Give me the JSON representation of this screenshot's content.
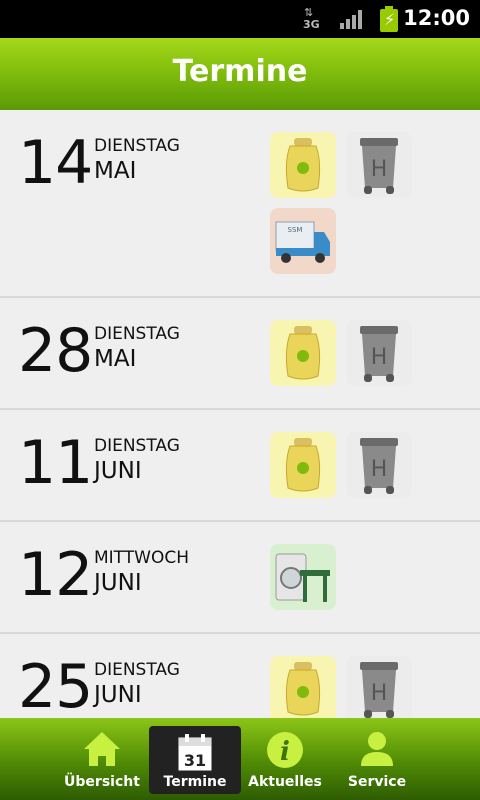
{
  "status": {
    "network": "3G",
    "time": "12:00"
  },
  "header": {
    "title": "Termine"
  },
  "rows": [
    {
      "day": "14",
      "weekday": "DIENSTAG",
      "month": "MAI",
      "icons": [
        "yellow-bag-icon",
        "grey-bin-icon",
        "truck-icon"
      ]
    },
    {
      "day": "28",
      "weekday": "DIENSTAG",
      "month": "MAI",
      "icons": [
        "yellow-bag-icon",
        "grey-bin-icon"
      ]
    },
    {
      "day": "11",
      "weekday": "DIENSTAG",
      "month": "JUNI",
      "icons": [
        "yellow-bag-icon",
        "grey-bin-icon"
      ]
    },
    {
      "day": "12",
      "weekday": "MITTWOCH",
      "month": "JUNI",
      "icons": [
        "washer-table-icon"
      ]
    },
    {
      "day": "25",
      "weekday": "DIENSTAG",
      "month": "JUNI",
      "icons": [
        "yellow-bag-icon",
        "grey-bin-icon"
      ]
    }
  ],
  "bin_letter": "H",
  "truck_label": "SSM",
  "nav": [
    {
      "label": "Übersicht",
      "icon": "home-icon"
    },
    {
      "label": "Termine",
      "icon": "calendar-icon",
      "calendar_day": "31",
      "active": true
    },
    {
      "label": "Aktuelles",
      "icon": "info-icon",
      "glyph": "i"
    },
    {
      "label": "Service",
      "icon": "person-icon"
    }
  ],
  "colors": {
    "accent": "#7fbb0c",
    "header_dark": "#5b9a07",
    "active_tab": "#222222"
  }
}
